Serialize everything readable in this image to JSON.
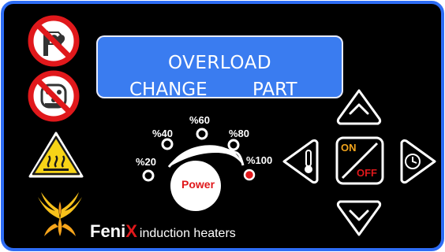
{
  "display": {
    "line1": "OVERLOAD",
    "line2_left": "CHANGE",
    "line2_right": "PART"
  },
  "dial": {
    "center_label": "Power",
    "levels": [
      "%20",
      "%40",
      "%60",
      "%80",
      "%100"
    ],
    "active_level": "%100",
    "active_color": "#e0181b"
  },
  "buttons": {
    "on_label": "ON",
    "off_label": "OFF",
    "on_color": "#f2a41c",
    "off_color": "#e0181b"
  },
  "brand": {
    "name_part1": "Feni",
    "name_part2": "X",
    "tagline": "induction heaters"
  },
  "warning_icons": [
    "no-pacemaker-icon",
    "no-metal-implants-icon",
    "hot-surface-warning-icon"
  ],
  "colors": {
    "panel_bg": "#000000",
    "panel_border": "#2e6df5",
    "lcd_bg": "#3a7cf0",
    "prohibition_red": "#e0181b",
    "warning_yellow": "#f7d417"
  }
}
